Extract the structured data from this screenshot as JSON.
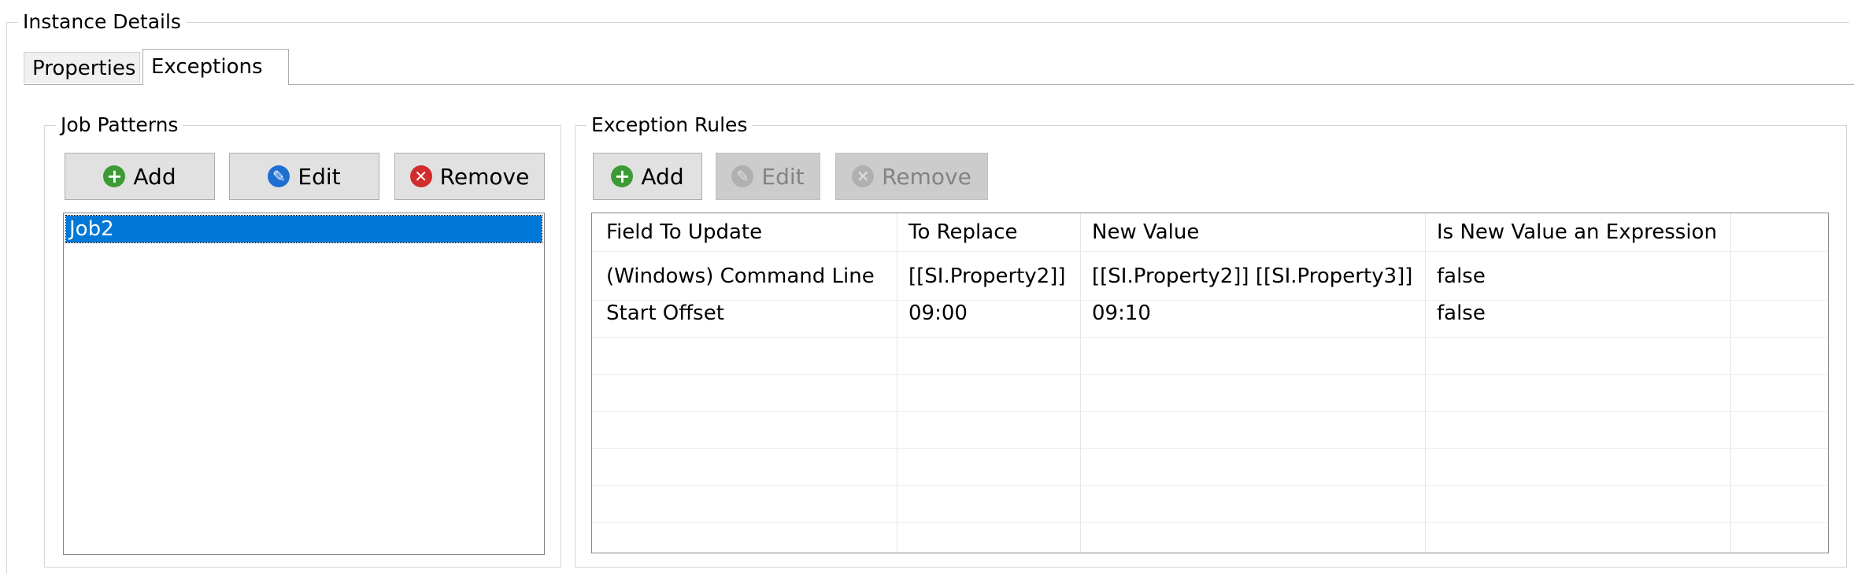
{
  "instance_title": "Instance Details",
  "tabs": [
    {
      "label": "Properties"
    },
    {
      "label": "Exceptions"
    }
  ],
  "job_patterns": {
    "title": "Job Patterns",
    "add_label": "Add",
    "edit_label": "Edit",
    "remove_label": "Remove",
    "items": [
      "Job2"
    ]
  },
  "exception_rules": {
    "title": "Exception Rules",
    "add_label": "Add",
    "edit_label": "Edit",
    "remove_label": "Remove",
    "columns": [
      "Field To Update",
      "To Replace",
      "New Value",
      "Is New Value an Expression"
    ],
    "rows": [
      [
        "(Windows) Command Line",
        "[[SI.Property2]]",
        "[[SI.Property2]] [[SI.Property3]]",
        "false"
      ],
      [
        "Start Offset",
        "09:00",
        "09:10",
        "false"
      ]
    ]
  },
  "colors": {
    "selection": "#0078d7",
    "add_icon": "#3d9b35",
    "edit_icon": "#1f6fd1",
    "remove_icon": "#d22c2c"
  }
}
